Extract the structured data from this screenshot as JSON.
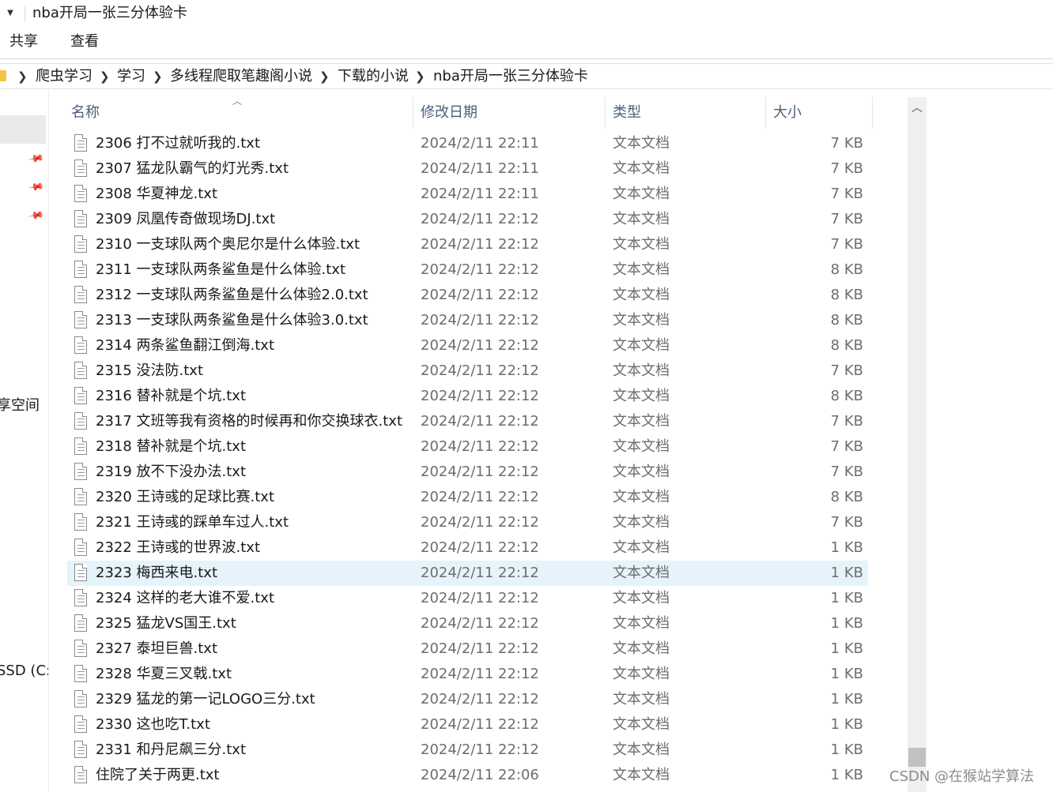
{
  "window": {
    "title": "nba开局一张三分体验卡",
    "qa_dropdown_icon": "chevron-down-icon"
  },
  "ribbon": {
    "tabs": [
      "共享",
      "查看"
    ]
  },
  "address": {
    "folder_icon": "folder-icon",
    "crumbs": [
      "爬虫学习",
      "学习",
      "多线程爬取笔趣阁小说",
      "下载的小说",
      "nba开局一张三分体验卡"
    ]
  },
  "nav": {
    "partial_label_1": "享空间",
    "partial_label_2": "SSD (C:)"
  },
  "columns": {
    "name": "名称",
    "date": "修改日期",
    "type": "类型",
    "size": "大小"
  },
  "files": [
    {
      "name": "2306 打不过就听我的.txt",
      "date": "2024/2/11 22:11",
      "type": "文本文档",
      "size": "7 KB"
    },
    {
      "name": "2307 猛龙队霸气的灯光秀.txt",
      "date": "2024/2/11 22:11",
      "type": "文本文档",
      "size": "7 KB"
    },
    {
      "name": "2308 华夏神龙.txt",
      "date": "2024/2/11 22:11",
      "type": "文本文档",
      "size": "7 KB"
    },
    {
      "name": "2309 凤凰传奇做现场DJ.txt",
      "date": "2024/2/11 22:12",
      "type": "文本文档",
      "size": "7 KB"
    },
    {
      "name": "2310 一支球队两个奥尼尔是什么体验.txt",
      "date": "2024/2/11 22:12",
      "type": "文本文档",
      "size": "7 KB"
    },
    {
      "name": "2311 一支球队两条鲨鱼是什么体验.txt",
      "date": "2024/2/11 22:12",
      "type": "文本文档",
      "size": "8 KB"
    },
    {
      "name": "2312 一支球队两条鲨鱼是什么体验2.0.txt",
      "date": "2024/2/11 22:12",
      "type": "文本文档",
      "size": "8 KB"
    },
    {
      "name": "2313 一支球队两条鲨鱼是什么体验3.0.txt",
      "date": "2024/2/11 22:12",
      "type": "文本文档",
      "size": "8 KB"
    },
    {
      "name": "2314 两条鲨鱼翻江倒海.txt",
      "date": "2024/2/11 22:12",
      "type": "文本文档",
      "size": "8 KB"
    },
    {
      "name": "2315 没法防.txt",
      "date": "2024/2/11 22:12",
      "type": "文本文档",
      "size": "7 KB"
    },
    {
      "name": "2316 替补就是个坑.txt",
      "date": "2024/2/11 22:12",
      "type": "文本文档",
      "size": "8 KB"
    },
    {
      "name": "2317 文班等我有资格的时候再和你交换球衣.txt",
      "date": "2024/2/11 22:12",
      "type": "文本文档",
      "size": "7 KB"
    },
    {
      "name": "2318 替补就是个坑.txt",
      "date": "2024/2/11 22:12",
      "type": "文本文档",
      "size": "7 KB"
    },
    {
      "name": "2319 放不下没办法.txt",
      "date": "2024/2/11 22:12",
      "type": "文本文档",
      "size": "7 KB"
    },
    {
      "name": "2320 王诗彧的足球比赛.txt",
      "date": "2024/2/11 22:12",
      "type": "文本文档",
      "size": "8 KB"
    },
    {
      "name": "2321 王诗彧的踩单车过人.txt",
      "date": "2024/2/11 22:12",
      "type": "文本文档",
      "size": "7 KB"
    },
    {
      "name": "2322 王诗彧的世界波.txt",
      "date": "2024/2/11 22:12",
      "type": "文本文档",
      "size": "1 KB"
    },
    {
      "name": "2323 梅西来电.txt",
      "date": "2024/2/11 22:12",
      "type": "文本文档",
      "size": "1 KB",
      "selected": true
    },
    {
      "name": "2324 这样的老大谁不爱.txt",
      "date": "2024/2/11 22:12",
      "type": "文本文档",
      "size": "1 KB"
    },
    {
      "name": "2325 猛龙VS国王.txt",
      "date": "2024/2/11 22:12",
      "type": "文本文档",
      "size": "1 KB"
    },
    {
      "name": "2327 泰坦巨兽.txt",
      "date": "2024/2/11 22:12",
      "type": "文本文档",
      "size": "1 KB"
    },
    {
      "name": "2328 华夏三叉戟.txt",
      "date": "2024/2/11 22:12",
      "type": "文本文档",
      "size": "1 KB"
    },
    {
      "name": "2329 猛龙的第一记LOGO三分.txt",
      "date": "2024/2/11 22:12",
      "type": "文本文档",
      "size": "1 KB"
    },
    {
      "name": "2330 这也吃T.txt",
      "date": "2024/2/11 22:12",
      "type": "文本文档",
      "size": "1 KB"
    },
    {
      "name": "2331 和丹尼飙三分.txt",
      "date": "2024/2/11 22:12",
      "type": "文本文档",
      "size": "1 KB"
    },
    {
      "name": "住院了关于两更.txt",
      "date": "2024/2/11 22:06",
      "type": "文本文档",
      "size": "1 KB"
    }
  ],
  "colors": {
    "selected_row": "#e5f3fb",
    "header_text": "#4c607a",
    "detail_text": "#6d6d6d"
  },
  "watermark": "CSDN @在猴站学算法"
}
